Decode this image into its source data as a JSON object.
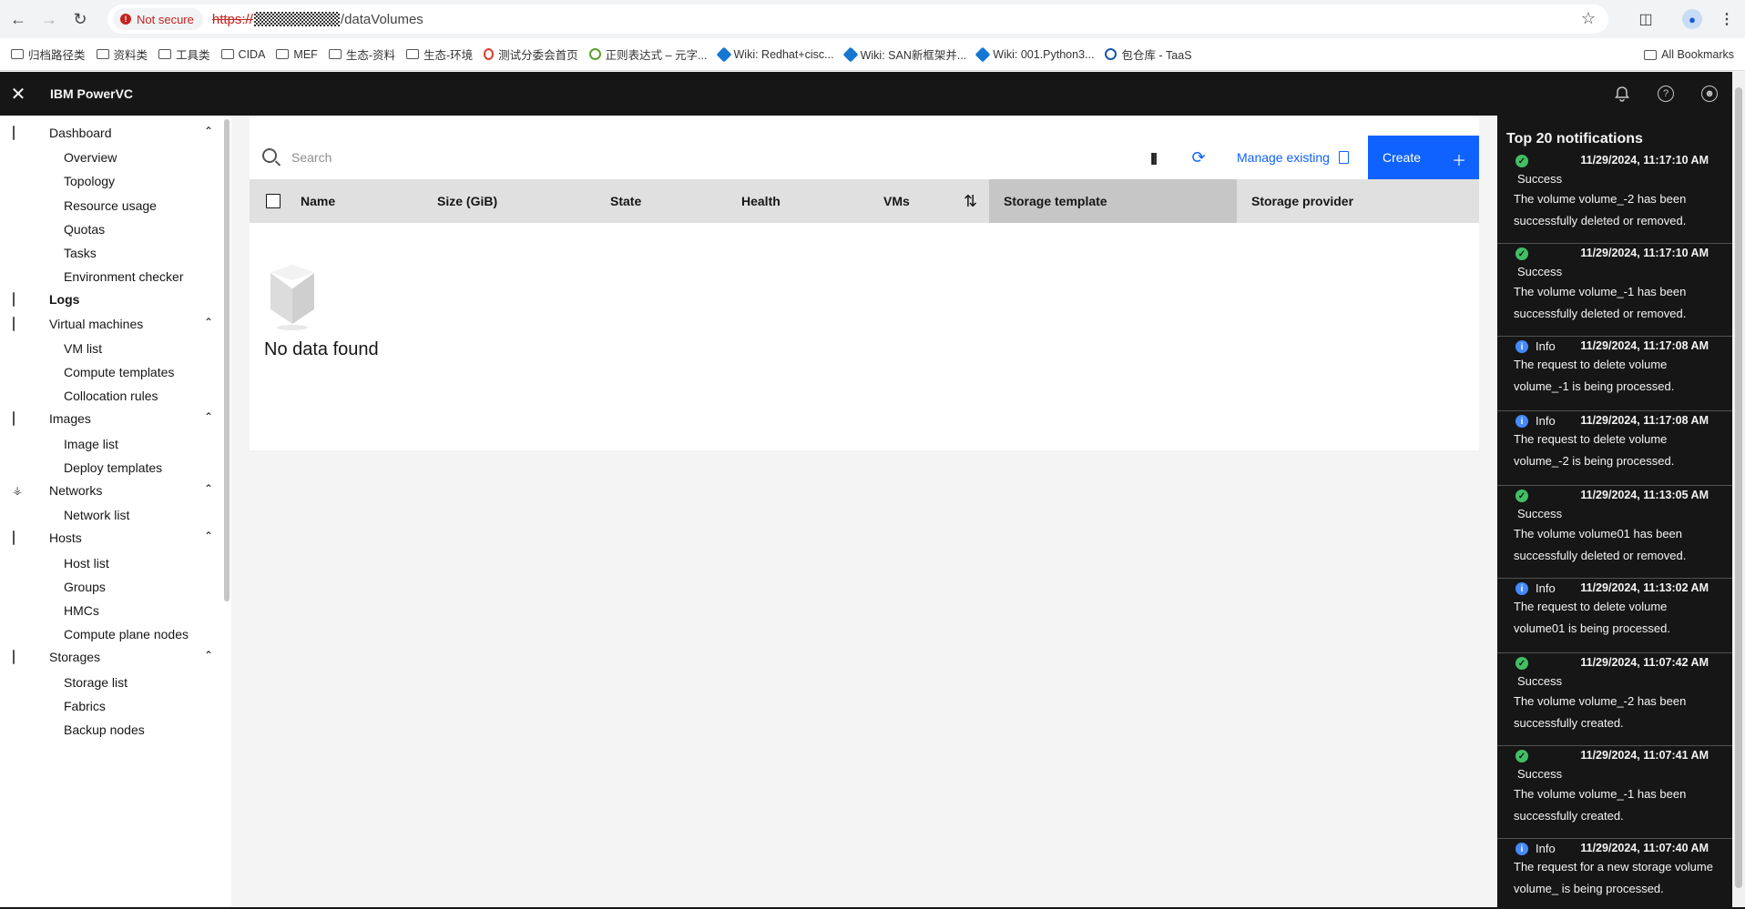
{
  "browser": {
    "security_label": "Not secure",
    "url_scheme": "https://",
    "url_path": "/dataVolumes",
    "bookmarks": [
      {
        "label": "归档路径类",
        "icon": "folder-icon"
      },
      {
        "label": "资料类",
        "icon": "folder-icon"
      },
      {
        "label": "工具类",
        "icon": "folder-icon"
      },
      {
        "label": "CIDA",
        "icon": "folder-icon"
      },
      {
        "label": "MEF",
        "icon": "folder-icon"
      },
      {
        "label": "生态-资料",
        "icon": "folder-icon"
      },
      {
        "label": "生态-环境",
        "icon": "folder-icon"
      },
      {
        "label": "测试分委会首页",
        "icon": "red-pin-icon"
      },
      {
        "label": "正则表达式 – 元字...",
        "icon": "green-icon"
      },
      {
        "label": "Wiki: Redhat+cisc...",
        "icon": "wiki-icon"
      },
      {
        "label": "Wiki: SAN新框架并...",
        "icon": "wiki-icon"
      },
      {
        "label": "Wiki: 001.Python3...",
        "icon": "wiki-icon"
      },
      {
        "label": "包仓库 - TaaS",
        "icon": "taas-icon"
      }
    ],
    "all_bookmarks_label": "All Bookmarks"
  },
  "app": {
    "title": "IBM PowerVC"
  },
  "sidenav": {
    "sections": [
      {
        "label": "Dashboard",
        "icon": "monitor-icon",
        "items": [
          "Overview",
          "Topology",
          "Resource usage",
          "Quotas",
          "Tasks",
          "Environment checker"
        ]
      },
      {
        "label": "Logs",
        "icon": "logs-icon",
        "items": []
      },
      {
        "label": "Virtual machines",
        "icon": "monitor-icon",
        "items": [
          "VM list",
          "Compute templates",
          "Collocation rules"
        ]
      },
      {
        "label": "Images",
        "icon": "camera-icon",
        "items": [
          "Image list",
          "Deploy templates"
        ]
      },
      {
        "label": "Networks",
        "icon": "network-icon",
        "items": [
          "Network list"
        ]
      },
      {
        "label": "Hosts",
        "icon": "hosts-icon",
        "items": [
          "Host list",
          "Groups",
          "HMCs",
          "Compute plane nodes"
        ]
      },
      {
        "label": "Storages",
        "icon": "storage-icon",
        "items": [
          "Storage list",
          "Fabrics",
          "Backup nodes"
        ]
      }
    ]
  },
  "toolbar": {
    "search_placeholder": "Search",
    "manage_existing_label": "Manage existing",
    "create_label": "Create"
  },
  "table": {
    "columns": [
      "Name",
      "Size (GiB)",
      "State",
      "Health",
      "VMs",
      "Storage template",
      "Storage provider"
    ],
    "rows": [],
    "empty_text": "No data found"
  },
  "notifications": {
    "title": "Top 20 notifications",
    "items": [
      {
        "kind": "Success",
        "time": "11/29/2024, 11:17:10 AM",
        "message": "The volume volume_-2 has been successfully deleted or removed."
      },
      {
        "kind": "Success",
        "time": "11/29/2024, 11:17:10 AM",
        "message": "The volume volume_-1 has been successfully deleted or removed."
      },
      {
        "kind": "Info",
        "time": "11/29/2024, 11:17:08 AM",
        "message": "The request to delete volume volume_-1 is being processed."
      },
      {
        "kind": "Info",
        "time": "11/29/2024, 11:17:08 AM",
        "message": "The request to delete volume volume_-2 is being processed."
      },
      {
        "kind": "Success",
        "time": "11/29/2024, 11:13:05 AM",
        "message": "The volume volume01 has been successfully deleted or removed."
      },
      {
        "kind": "Info",
        "time": "11/29/2024, 11:13:02 AM",
        "message": "The request to delete volume volume01 is being processed."
      },
      {
        "kind": "Success",
        "time": "11/29/2024, 11:07:42 AM",
        "message": "The volume volume_-2 has been successfully created."
      },
      {
        "kind": "Success",
        "time": "11/29/2024, 11:07:41 AM",
        "message": "The volume volume_-1 has been successfully created."
      },
      {
        "kind": "Info",
        "time": "11/29/2024, 11:07:40 AM",
        "message": "The request for a new storage volume volume_ is being processed."
      }
    ]
  }
}
